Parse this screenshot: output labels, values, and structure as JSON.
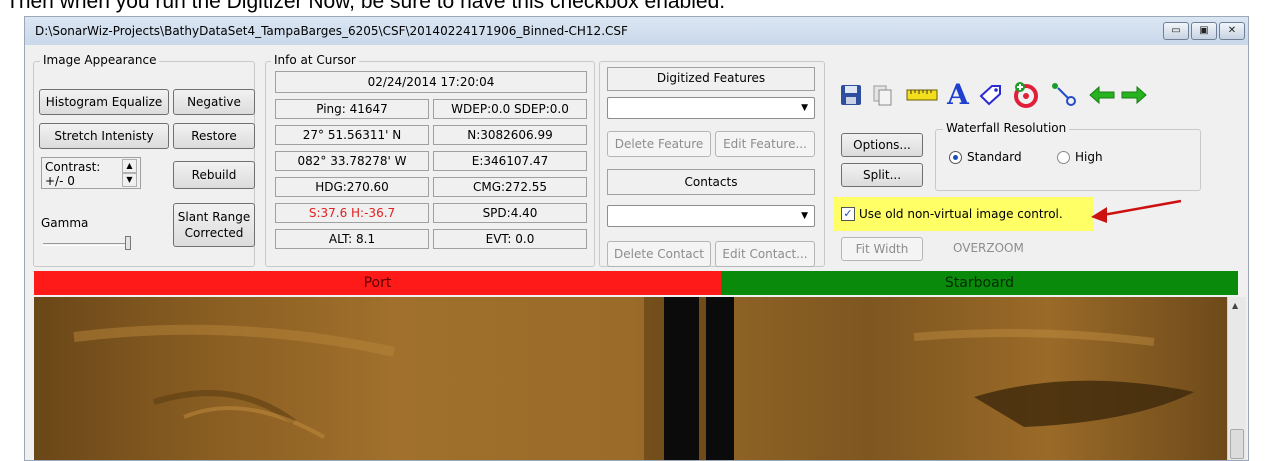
{
  "caption": "Then when you run the Digitizer Now, be sure to have this checkbox enabled.",
  "window": {
    "title": "D:\\SonarWiz-Projects\\BathyDataSet4_TampaBarges_6205\\CSF\\20140224171906_Binned-CH12.CSF",
    "minimize_glyph": "▭",
    "maximize_glyph": "▣",
    "close_glyph": "✕"
  },
  "image_appearance": {
    "legend": "Image Appearance",
    "histogram_equalize": "Histogram Equalize",
    "negative": "Negative",
    "stretch_intensity": "Stretch Intenisty",
    "restore": "Restore",
    "contrast_label": "Contrast:",
    "contrast_value": "+/- 0",
    "rebuild": "Rebuild",
    "gamma_label": "Gamma",
    "slant_range_line1": "Slant Range",
    "slant_range_line2": "Corrected"
  },
  "info_at_cursor": {
    "legend": "Info at Cursor",
    "datetime": "02/24/2014 17:20:04",
    "ping": "Ping: 41647",
    "wdep": "WDEP:0.0 SDEP:0.0",
    "lat": "27° 51.56311' N",
    "northing": "N:3082606.99",
    "lon": "082° 33.78278' W",
    "easting": "E:346107.47",
    "hdg": "HDG:270.60",
    "cmg": "CMG:272.55",
    "slant": "S:37.6 H:-36.7",
    "spd": "SPD:4.40",
    "alt": "ALT: 8.1",
    "evt": "EVT: 0.0",
    "slant_color": "#e02020"
  },
  "digitized": {
    "features_header": "Digitized Features",
    "delete_feature": "Delete Feature",
    "edit_feature": "Edit Feature...",
    "contacts_header": "Contacts",
    "delete_contact": "Delete Contact",
    "edit_contact": "Edit Contact..."
  },
  "tools": {
    "options": "Options...",
    "split": "Split...",
    "fit_width": "Fit Width",
    "overzoom": "OVERZOOM",
    "waterfall_legend": "Waterfall Resolution",
    "standard": "Standard",
    "high": "High",
    "checkbox_label": "Use old non-virtual image control.",
    "highlight_color": "#ffff66",
    "arrow_color": "#cc1111",
    "icons": [
      "save-icon",
      "copy-icon",
      "ruler-icon",
      "text-icon",
      "tag-icon",
      "add-target-icon",
      "path-tool-icon",
      "back-arrow-icon",
      "forward-arrow-icon"
    ]
  },
  "channels": {
    "port": "Port",
    "starboard": "Starboard",
    "port_color": "#ff1a1a",
    "starboard_color": "#0a8a0a"
  }
}
